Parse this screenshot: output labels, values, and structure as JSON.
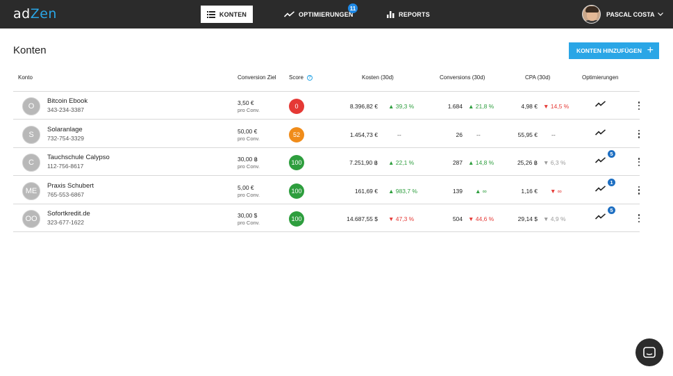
{
  "app": {
    "logo_prefix": "ad",
    "logo_accent": "Zen",
    "accent_color": "#2aa6e6"
  },
  "nav": {
    "konten": "KONTEN",
    "optimierungen": "OPTIMIERUNGEN",
    "optimierungen_badge": "11",
    "reports": "REPORTS",
    "user_name": "PASCAL COSTA"
  },
  "page": {
    "title": "Konten",
    "add_button": "KONTEN HINZUFÜGEN",
    "add_button_plus": "+"
  },
  "columns": {
    "konto": "Konto",
    "conversion_ziel": "Conversion Ziel",
    "score": "Score",
    "score_info": "?",
    "kosten": "Kosten (30d)",
    "conversions": "Conversions (30d)",
    "cpa": "CPA (30d)",
    "optimierungen": "Optimierungen"
  },
  "rows": [
    {
      "initials": "O",
      "name": "Bitcoin Ebook",
      "id": "343-234-3387",
      "ziel": "3,50 €",
      "ziel_sub": "pro Conv.",
      "score": "0",
      "score_color": "#e53935",
      "kosten": "8.396,82 €",
      "kosten_trend": "39,3 %",
      "kosten_dir": "up",
      "conv": "1.684",
      "conv_trend": "21,8 %",
      "conv_dir": "up",
      "cpa": "4,98 €",
      "cpa_trend": "14,5 %",
      "cpa_dir": "down",
      "opt_badge": ""
    },
    {
      "initials": "S",
      "name": "Solaranlage",
      "id": "732-754-3329",
      "ziel": "50,00 €",
      "ziel_sub": "pro Conv.",
      "score": "52",
      "score_color": "#f08c1a",
      "kosten": "1.454,73 €",
      "kosten_trend": "--",
      "kosten_dir": "neutral",
      "conv": "26",
      "conv_trend": "--",
      "conv_dir": "neutral",
      "cpa": "55,95 €",
      "cpa_trend": "--",
      "cpa_dir": "neutral",
      "opt_badge": ""
    },
    {
      "initials": "C",
      "name": "Tauchschule Calypso",
      "id": "112-756-8617",
      "ziel": "30,00 ฿",
      "ziel_sub": "pro Conv.",
      "score": "100",
      "score_color": "#2e9e3e",
      "kosten": "7.251,90 ฿",
      "kosten_trend": "22,1 %",
      "kosten_dir": "up",
      "conv": "287",
      "conv_trend": "14,8 %",
      "conv_dir": "up",
      "cpa": "25,26 ฿",
      "cpa_trend": "6,3 %",
      "cpa_dir": "grey",
      "opt_badge": "5"
    },
    {
      "initials": "ME",
      "name": "Praxis Schubert",
      "id": "765-553-6867",
      "ziel": "5,00 €",
      "ziel_sub": "pro Conv.",
      "score": "100",
      "score_color": "#2e9e3e",
      "kosten": "161,69 €",
      "kosten_trend": "983,7 %",
      "kosten_dir": "up",
      "conv": "139",
      "conv_trend": "∞",
      "conv_dir": "up",
      "cpa": "1,16 €",
      "cpa_trend": "∞",
      "cpa_dir": "down",
      "opt_badge": "1"
    },
    {
      "initials": "OO",
      "name": "Sofortkredit.de",
      "id": "323-677-1622",
      "ziel": "30,00 $",
      "ziel_sub": "pro Conv.",
      "score": "100",
      "score_color": "#2e9e3e",
      "kosten": "14.687,55 $",
      "kosten_trend": "47,3 %",
      "kosten_dir": "down",
      "conv": "504",
      "conv_trend": "44,6 %",
      "conv_dir": "down",
      "cpa": "29,14 $",
      "cpa_trend": "4,9 %",
      "cpa_dir": "grey",
      "opt_badge": "5"
    }
  ]
}
